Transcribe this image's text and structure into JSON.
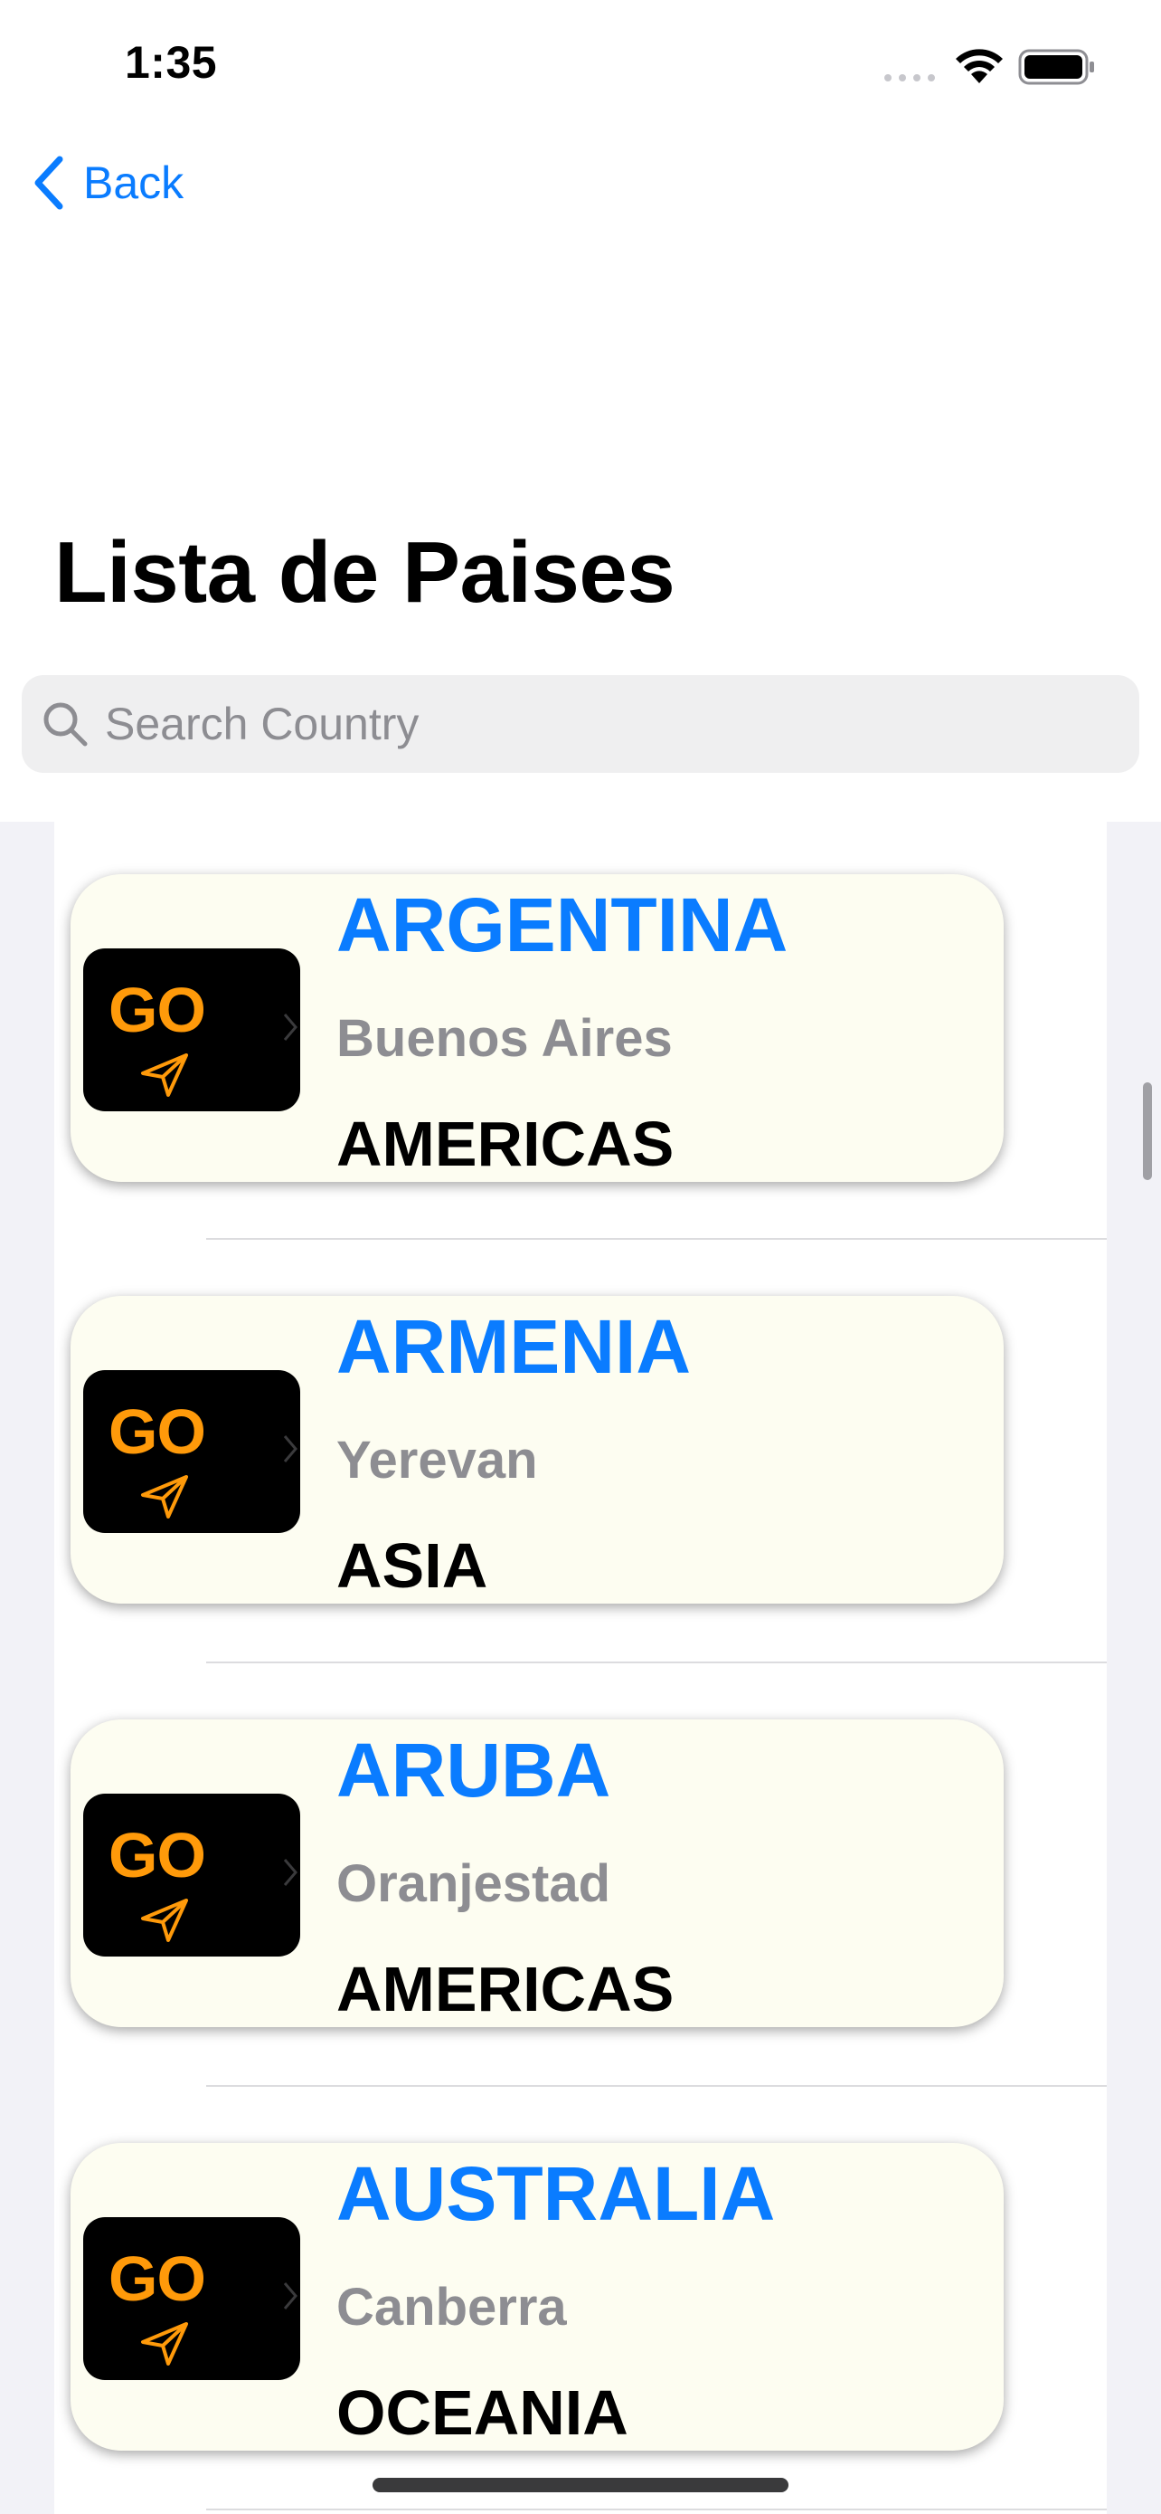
{
  "status_bar": {
    "time": "1:35"
  },
  "nav": {
    "back_label": "Back"
  },
  "title": "Lista de Paises",
  "search": {
    "placeholder": "Search Country",
    "value": ""
  },
  "go_label": "GO",
  "countries": [
    {
      "name": "ARGENTINA",
      "capital": "Buenos Aires",
      "region": "AMERICAS"
    },
    {
      "name": "ARMENIA",
      "capital": "Yerevan",
      "region": "ASIA"
    },
    {
      "name": "ARUBA",
      "capital": "Oranjestad",
      "region": "AMERICAS"
    },
    {
      "name": "AUSTRALIA",
      "capital": "Canberra",
      "region": "OCEANIA"
    }
  ],
  "colors": {
    "accent": "#0a7cff",
    "go_text": "#ff9a0a",
    "card_bg": "#fdfdf1",
    "capital_text": "#8d8d92"
  },
  "icons": {
    "back": "chevron-left-icon",
    "search": "magnifying-glass-icon",
    "go": "location-arrow-icon",
    "wifi": "wifi-icon",
    "battery": "battery-icon"
  }
}
